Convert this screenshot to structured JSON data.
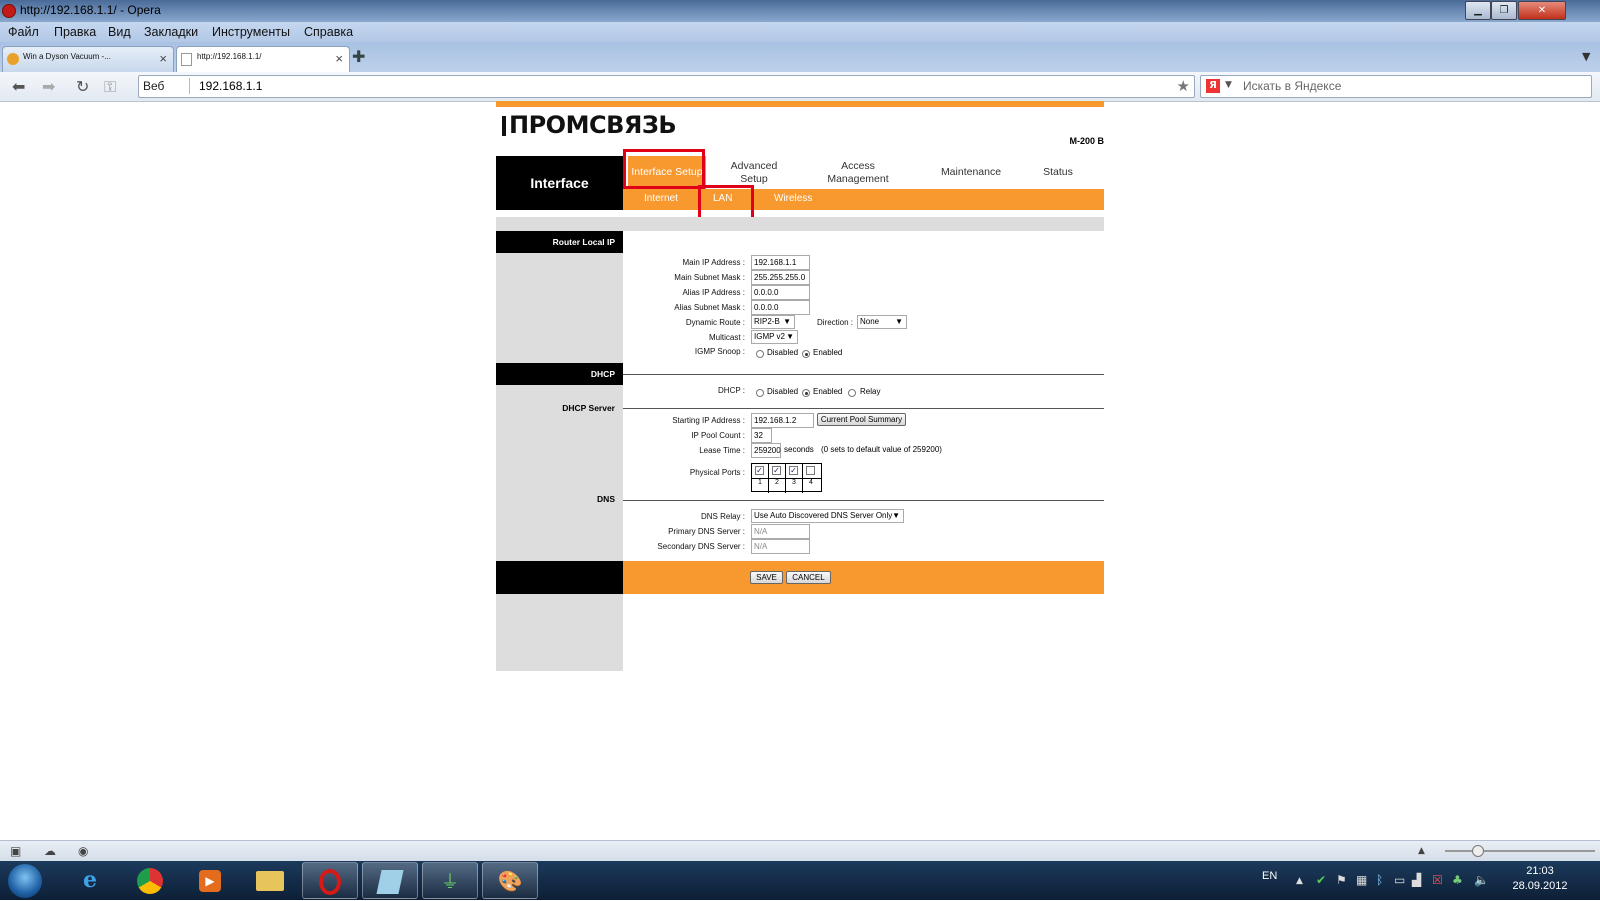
{
  "window": {
    "title": "http://192.168.1.1/ - Opera",
    "minimize": "▁",
    "restore": "❐",
    "close": "✕"
  },
  "menubar": [
    "Файл",
    "Правка",
    "Вид",
    "Закладки",
    "Инструменты",
    "Справка"
  ],
  "tabs": [
    {
      "label": "Win a Dyson Vacuum -...",
      "close": "×"
    },
    {
      "label": "http://192.168.1.1/",
      "close": "×"
    }
  ],
  "addressbar": {
    "web_label": "Веб",
    "url": "192.168.1.1",
    "search_placeholder": "Искать в Яндексе",
    "search_logo": "Я"
  },
  "router": {
    "brand": "ПРОМСВЯЗЬ",
    "model": "M-200 B",
    "section_title": "Interface",
    "topnav": [
      "Interface Setup",
      "Advanced Setup",
      "Access Management",
      "Maintenance",
      "Status"
    ],
    "subnav": [
      "Internet",
      "LAN",
      "Wireless"
    ],
    "router_local_ip": {
      "header": "Router Local IP",
      "main_ip_label": "Main IP Address :",
      "main_ip": "192.168.1.1",
      "main_mask_label": "Main Subnet Mask :",
      "main_mask": "255.255.255.0",
      "alias_ip_label": "Alias IP Address :",
      "alias_ip": "0.0.0.0",
      "alias_mask_label": "Alias Subnet Mask :",
      "alias_mask": "0.0.0.0",
      "dynamic_route_label": "Dynamic Route :",
      "dynamic_route": "RIP2-B",
      "direction_label": "Direction :",
      "direction": "None",
      "multicast_label": "Multicast :",
      "multicast": "IGMP v2",
      "igmp_snoop_label": "IGMP Snoop :",
      "igmp_disabled": "Disabled",
      "igmp_enabled": "Enabled"
    },
    "dhcp": {
      "header": "DHCP",
      "dhcp_label": "DHCP :",
      "opt_disabled": "Disabled",
      "opt_enabled": "Enabled",
      "opt_relay": "Relay",
      "server_header": "DHCP Server",
      "start_ip_label": "Starting IP Address :",
      "start_ip": "192.168.1.2",
      "pool_summary_btn": "Current Pool Summary",
      "pool_count_label": "IP Pool Count :",
      "pool_count": "32",
      "lease_label": "Lease Time :",
      "lease": "259200",
      "lease_unit": "seconds",
      "lease_note": "(0 sets to default value of 259200)",
      "ports_label": "Physical Ports :",
      "ports": [
        "1",
        "2",
        "3",
        "4"
      ],
      "ports_checked": [
        true,
        true,
        true,
        false
      ]
    },
    "dns": {
      "header": "DNS",
      "relay_label": "DNS Relay :",
      "relay": "Use Auto Discovered DNS Server Only",
      "primary_label": "Primary DNS Server :",
      "primary": "N/A",
      "secondary_label": "Secondary DNS Server :",
      "secondary": "N/A"
    },
    "save_btn": "SAVE",
    "cancel_btn": "CANCEL"
  },
  "taskbar": {
    "language": "EN",
    "time": "21:03",
    "date": "28.09.2012"
  }
}
